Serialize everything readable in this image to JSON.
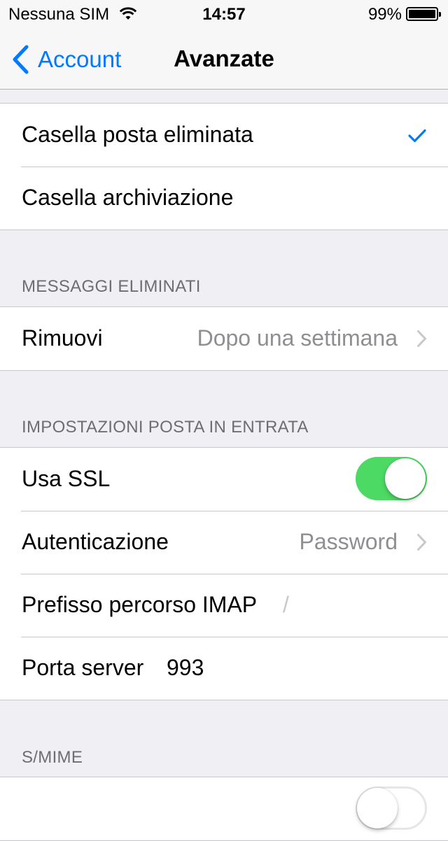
{
  "status_bar": {
    "carrier": "Nessuna SIM",
    "time": "14:57",
    "battery_percent": "99%",
    "battery_level": 0.99
  },
  "nav": {
    "back_label": "Account",
    "title": "Avanzate",
    "accent_color": "#007aff"
  },
  "mailbox_group": {
    "items": [
      {
        "label": "Casella posta eliminata",
        "selected": true
      },
      {
        "label": "Casella archiviazione",
        "selected": false
      }
    ]
  },
  "deleted_messages": {
    "header": "MESSAGGI ELIMINATI",
    "remove_label": "Rimuovi",
    "remove_value": "Dopo una settimana"
  },
  "incoming_settings": {
    "header": "IMPOSTAZIONI POSTA IN ENTRATA",
    "ssl_label": "Usa SSL",
    "ssl_enabled": true,
    "auth_label": "Autenticazione",
    "auth_value": "Password",
    "imap_prefix_label": "Prefisso percorso IMAP",
    "imap_prefix_value": "/",
    "port_label": "Porta server",
    "port_value": "993"
  },
  "smime": {
    "header": "S/MIME",
    "toggle_enabled": false
  },
  "colors": {
    "switch_on": "#4cd964",
    "background": "#efeff4",
    "secondary_text": "#8e8e93"
  }
}
